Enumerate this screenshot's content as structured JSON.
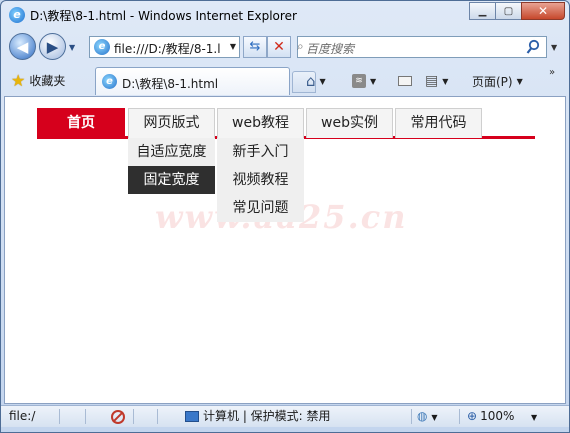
{
  "window": {
    "title": "D:\\教程\\8-1.html - Windows Internet Explorer",
    "minimize_glyph": "▁",
    "maximize_glyph": "▢",
    "close_glyph": "✕"
  },
  "address_bar": {
    "url": "file:///D:/教程/8-1.l"
  },
  "search": {
    "placeholder": "百度搜索"
  },
  "toolbar": {
    "favorites_label": "收藏夹",
    "tab_title": "D:\\教程\\8-1.html",
    "page_menu_label": "页面(P)"
  },
  "page": {
    "nav_items": [
      {
        "label": "首页",
        "active": true
      },
      {
        "label": "网页版式",
        "active": false
      },
      {
        "label": "web教程",
        "active": false
      },
      {
        "label": "web实例",
        "active": false
      },
      {
        "label": "常用代码",
        "active": false
      }
    ],
    "submenu_layout": [
      "自适应宽度",
      "固定宽度"
    ],
    "submenu_tutorial": [
      "新手入门",
      "视频教程",
      "常见问题"
    ],
    "watermark": "www.aa25.cn",
    "accent_color": "#d6001c"
  },
  "status_bar": {
    "left_text": "file:/",
    "zone_text": "计算机 | 保护模式: 禁用",
    "zoom_text": "100%"
  }
}
